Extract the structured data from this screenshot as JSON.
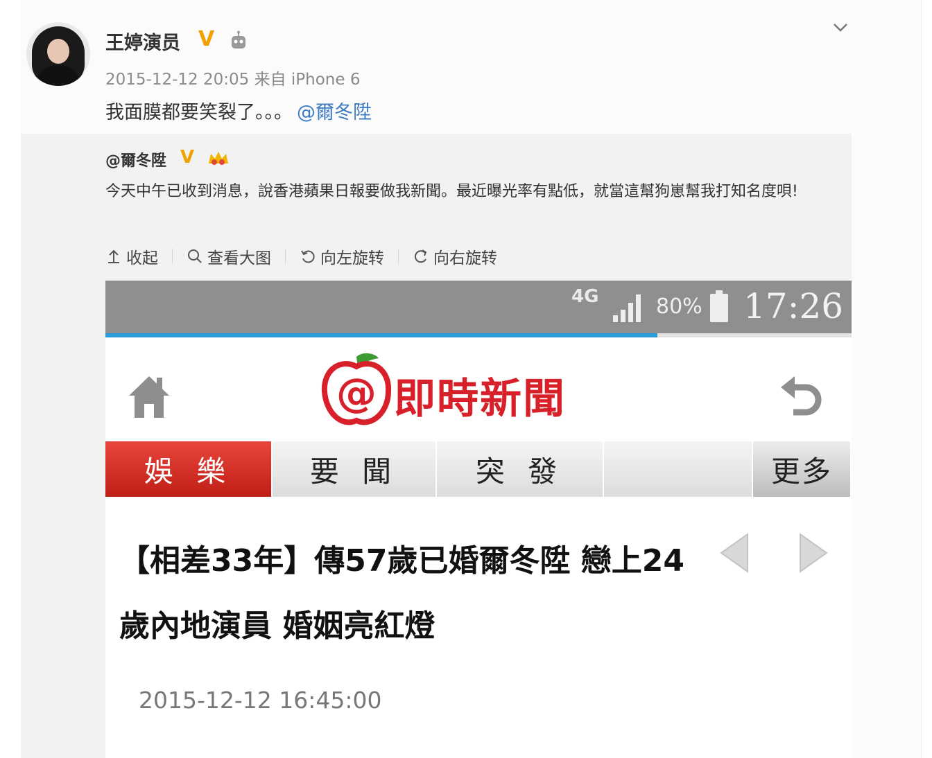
{
  "post": {
    "username": "王婷演员",
    "v_badge": "V",
    "timestamp": "2015-12-12 20:05 来自 iPhone 6",
    "text": "我面膜都要笑裂了。。。",
    "mention": "@爾冬陞"
  },
  "repost": {
    "username": "@爾冬陞",
    "v_badge": "V",
    "text": "今天中午已收到消息，說香港蘋果日報要做我新聞。最近曝光率有點低，就當這幫狗崽幫我打知名度唄!"
  },
  "actions": {
    "collapse": "收起",
    "view_large": "查看大图",
    "rotate_left": "向左旋转",
    "rotate_right": "向右旋转"
  },
  "phone": {
    "network": "4G",
    "battery": "80%",
    "time": "17:26",
    "page_load_progress": 0.74,
    "app_title": "即時新聞",
    "tabs": [
      "娛 樂",
      "要 聞",
      "突 發",
      "",
      "更多"
    ],
    "active_tab": 0,
    "headline": "【相差33年】傳57歲已婚爾冬陞 戀上24歲內地演員 婚姻亮紅燈",
    "article_time": "2015-12-12 16:45:00"
  },
  "colors": {
    "mention_blue": "#3d7cc4",
    "badge_gold": "#f0a300",
    "brand_red": "#d8202a"
  }
}
